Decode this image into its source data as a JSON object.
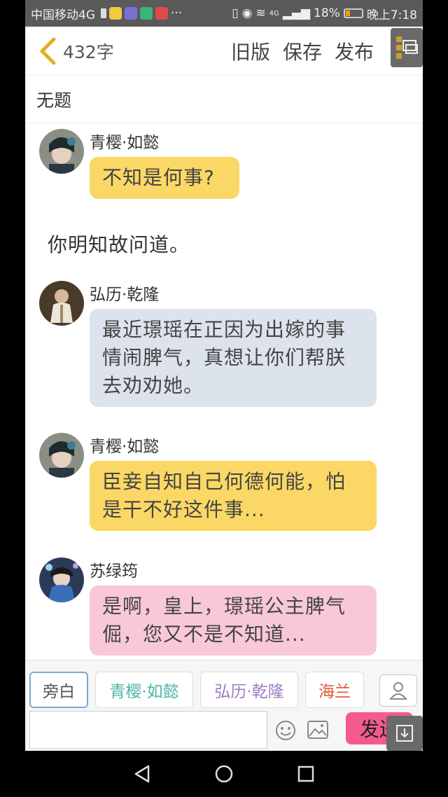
{
  "status": {
    "carrier": "中国移动4G",
    "more": "···",
    "network": "4G",
    "battery": "18%",
    "time": "晚上7:18"
  },
  "topbar": {
    "count": "432字",
    "old_version": "旧版",
    "save": "保存",
    "publish": "发布"
  },
  "doc": {
    "title": "无题"
  },
  "messages": [
    {
      "name": "青樱·如懿",
      "text": "不知是何事?",
      "color": "#fbd865"
    },
    {
      "narration": "你明知故问道。"
    },
    {
      "name": "弘历·乾隆",
      "text": "最近璟瑶在正因为出嫁的事情闹脾气，真想让你们帮朕去劝劝她。",
      "color": "#dde3ec"
    },
    {
      "name": "青樱·如懿",
      "text": "臣妾自知自己何德何能，怕是干不好这件事...",
      "color": "#fbd865"
    },
    {
      "name": "苏绿筠",
      "text": "是啊，皇上，璟瑶公主脾气倔，您又不是不知道...",
      "color": "#f9c8d7"
    }
  ],
  "roles": [
    {
      "label": "旁白",
      "color": "#555555"
    },
    {
      "label": "青樱·如懿",
      "color": "#4db6a6"
    },
    {
      "label": "弘历·乾隆",
      "color": "#9c7ec2"
    },
    {
      "label": "海兰",
      "color": "#e05a3a"
    }
  ],
  "composer": {
    "send": "发送",
    "placeholder": ""
  }
}
